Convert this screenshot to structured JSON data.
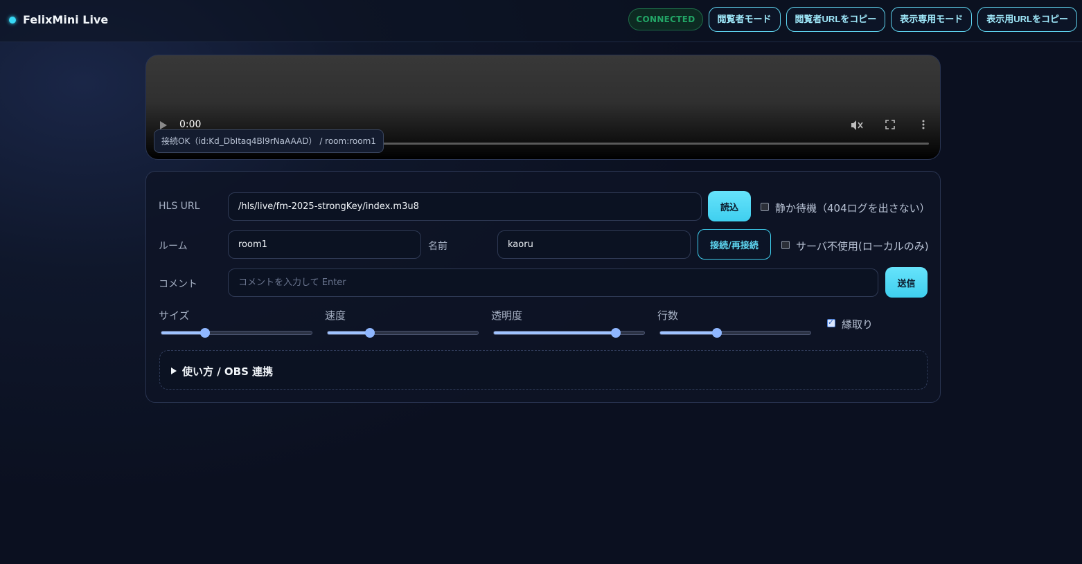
{
  "header": {
    "title": "FelixMini Live",
    "status": "CONNECTED",
    "buttons": {
      "viewer_mode": "閲覧者モード",
      "copy_viewer_url": "閲覧者URLをコピー",
      "display_only_mode": "表示専用モード",
      "copy_display_url": "表示用URLをコピー"
    },
    "colors": {
      "accent": "#38d9f5",
      "connected": "#22a566"
    }
  },
  "video": {
    "time": "0:00",
    "status_text": "接続OK（id:Kd_DbItaq4Bl9rNaAAAD） / room:room1",
    "icons": [
      "play-icon",
      "mute-icon",
      "fullscreen-icon",
      "more-vert-icon"
    ]
  },
  "form": {
    "hls": {
      "label": "HLS URL",
      "value": "/hls/live/fm-2025-strongKey/index.m3u8",
      "load_button": "読込",
      "quiet_label": "静か待機（404ログを出さない）",
      "quiet_checked": false
    },
    "room": {
      "label": "ルーム",
      "value": "room1"
    },
    "name": {
      "label": "名前",
      "value": "kaoru"
    },
    "connect_button": "接続/再接続",
    "no_server": {
      "label": "サーバ不使用(ローカルのみ)",
      "checked": false
    },
    "comment": {
      "label": "コメント",
      "placeholder": "コメントを入力して Enter",
      "send_button": "送信"
    },
    "sliders": [
      {
        "label": "サイズ",
        "value": 0.29
      },
      {
        "label": "速度",
        "value": 0.28
      },
      {
        "label": "透明度",
        "value": 0.81
      },
      {
        "label": "行数",
        "value": 0.38
      }
    ],
    "outline": {
      "label": "縁取り",
      "checked": true
    },
    "help": {
      "title": "使い方 / OBS 連携"
    }
  }
}
